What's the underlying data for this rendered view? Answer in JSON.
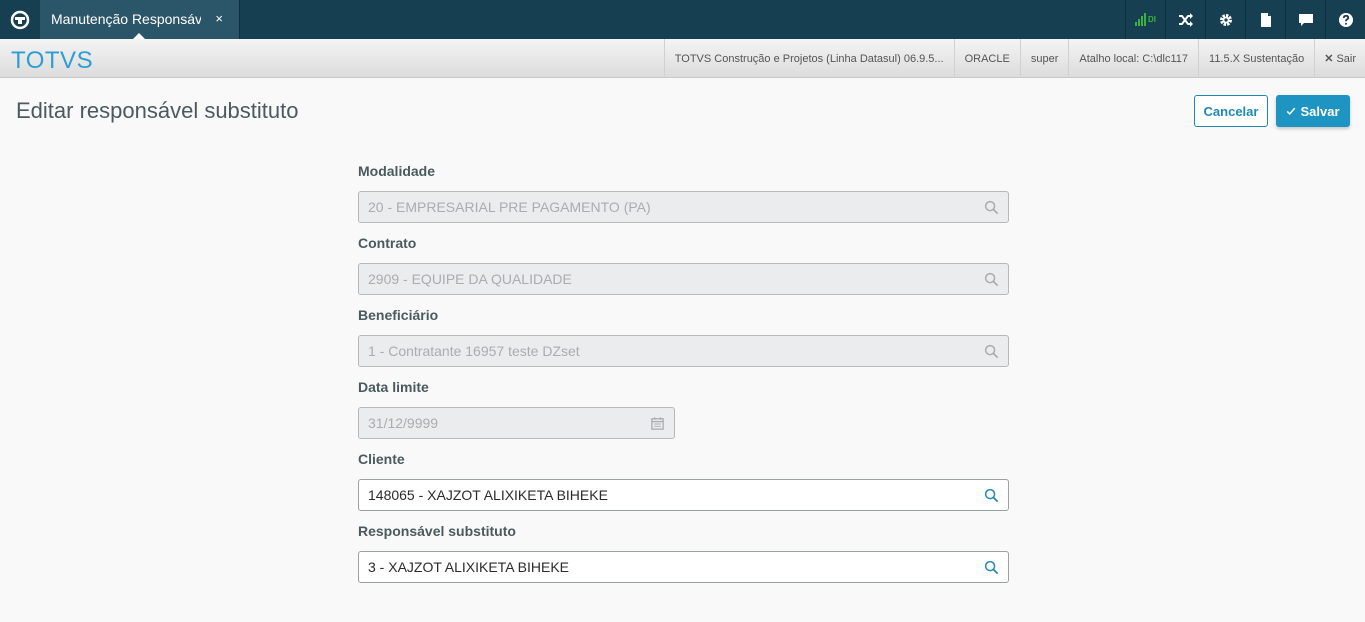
{
  "topbar": {
    "tab_label": "Manutenção Responsável",
    "tab_close": "×",
    "connection_indicator": "DI"
  },
  "subbar": {
    "brand": "TOTVS",
    "items": [
      "TOTVS Construção e Projetos (Linha Datasul) 06.9.5...",
      "ORACLE",
      "super",
      "Atalho local: C:\\dlc117",
      "11.5.X Sustentação"
    ],
    "exit_label": "Sair"
  },
  "page": {
    "title": "Editar responsável substituto",
    "cancel_label": "Cancelar",
    "save_label": "Salvar"
  },
  "form": {
    "modalidade": {
      "label": "Modalidade",
      "value": "20 - EMPRESARIAL PRE PAGAMENTO (PA)"
    },
    "contrato": {
      "label": "Contrato",
      "value": "2909 - EQUIPE DA QUALIDADE"
    },
    "beneficiario": {
      "label": "Beneficiário",
      "value": "1 - Contratante 16957 teste DZset"
    },
    "data_limite": {
      "label": "Data limite",
      "value": "31/12/9999"
    },
    "cliente": {
      "label": "Cliente",
      "value": "148065 - XAJZOT ALIXIKETA BIHEKE"
    },
    "responsavel": {
      "label": "Responsável substituto",
      "value": "3 - XAJZOT ALIXIKETA BIHEKE"
    }
  },
  "colors": {
    "topbar": "#173f52",
    "brand": "#2e9ed3",
    "primary": "#1e94c2",
    "signal": "#37b340"
  },
  "icons": [
    "app-logo-icon",
    "signal-icon",
    "shuffle-icon",
    "gear-icon",
    "document-icon",
    "chat-icon",
    "help-icon",
    "search-icon",
    "calendar-icon",
    "check-icon",
    "close-icon"
  ]
}
